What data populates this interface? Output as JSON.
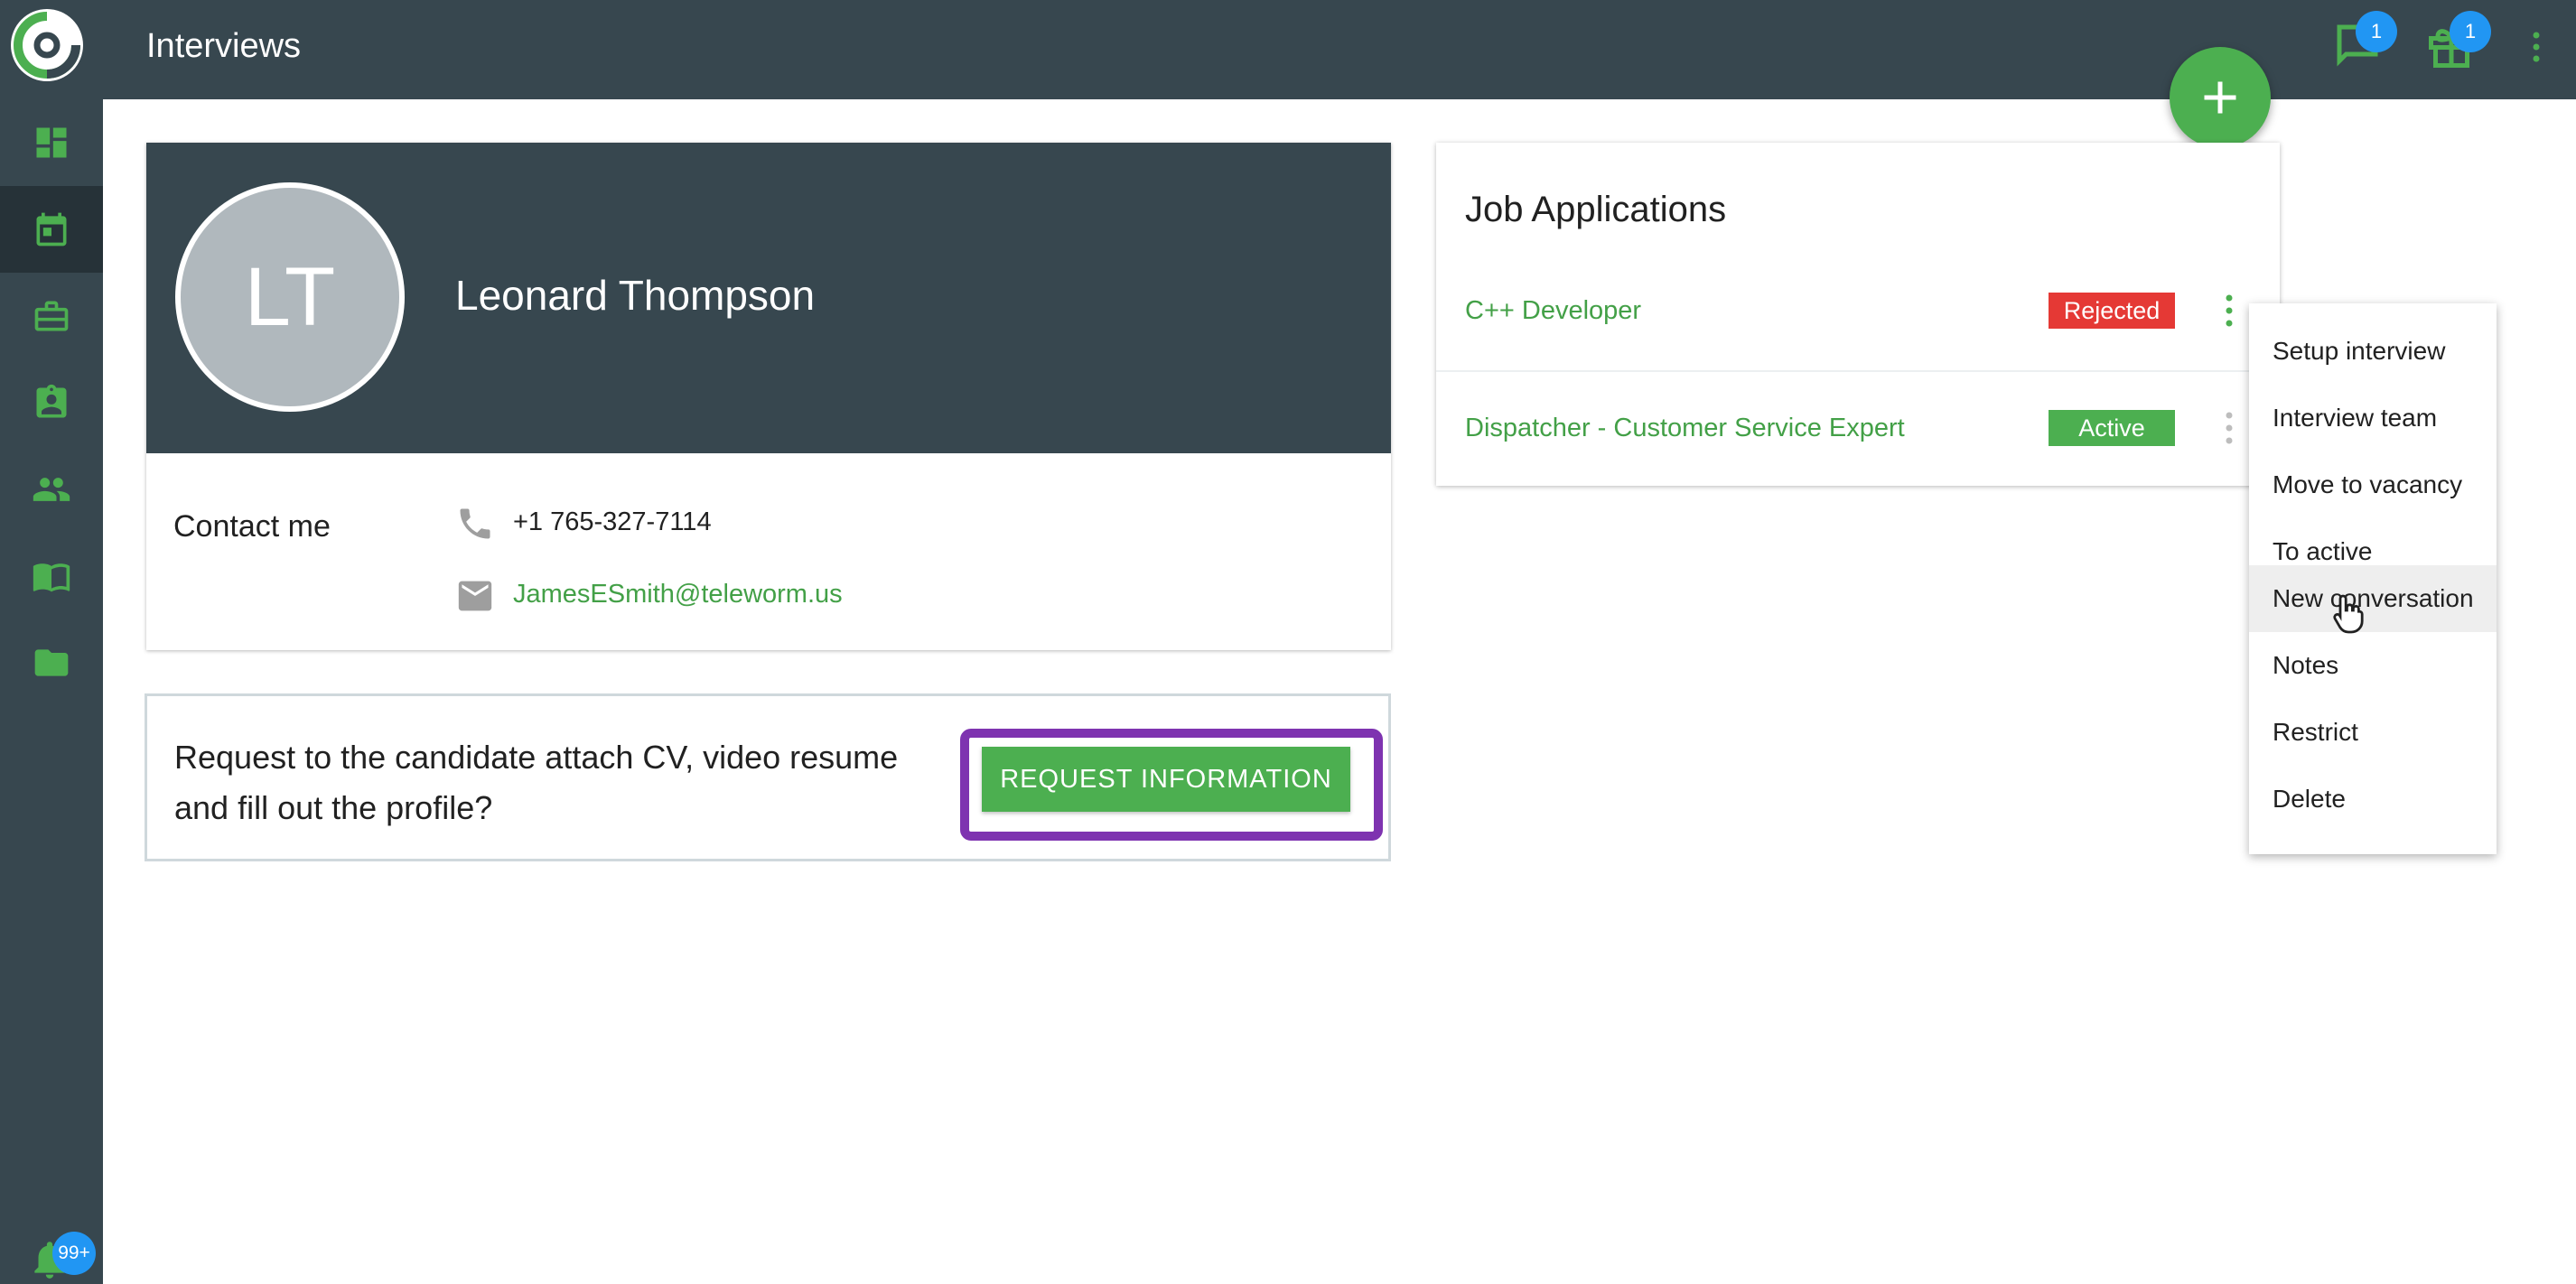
{
  "app": {
    "title": "Interviews"
  },
  "sidebar": {
    "items": [
      {
        "icon": "dashboard-icon"
      },
      {
        "icon": "calendar-icon",
        "active": true
      },
      {
        "icon": "briefcase-icon"
      },
      {
        "icon": "id-badge-icon"
      },
      {
        "icon": "people-icon"
      },
      {
        "icon": "book-icon"
      },
      {
        "icon": "folder-icon"
      }
    ],
    "notifications_badge": "99+"
  },
  "header": {
    "messages_badge": "1",
    "gifts_badge": "1"
  },
  "profile": {
    "initials": "LT",
    "name": "Leonard Thompson",
    "contact_label": "Contact me",
    "phone": "+1 765-327-7114",
    "email": "JamesESmith@teleworm.us"
  },
  "request": {
    "text": "Request to the candidate attach CV, video resume and fill out the profile?",
    "button_label": "REQUEST INFORMATION"
  },
  "jobs": {
    "title": "Job Applications",
    "items": [
      {
        "title": "C++ Developer",
        "status": "Rejected"
      },
      {
        "title": "Dispatcher - Customer Service Expert",
        "status": "Active"
      }
    ]
  },
  "menu": {
    "items": [
      "Setup interview",
      "Interview team",
      "Move to vacancy",
      "To active",
      "New conversation",
      "Notes",
      "Restrict",
      "Delete"
    ],
    "hovered": "New conversation"
  },
  "colors": {
    "primary_dark": "#37474f",
    "accent_green": "#4caf50",
    "rejected_red": "#e53935",
    "badge_blue": "#2196f3",
    "highlight_purple": "#7e33b0"
  }
}
